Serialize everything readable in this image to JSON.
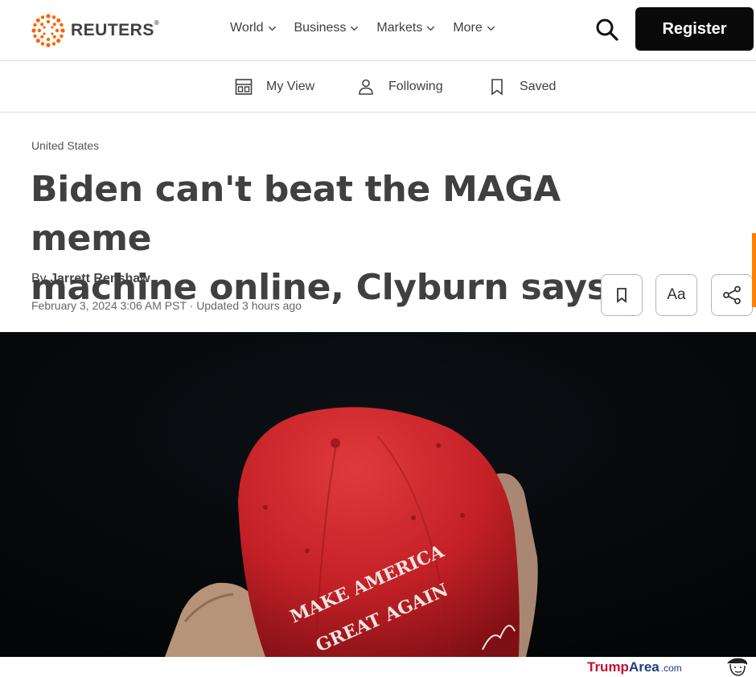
{
  "brand": {
    "name": "REUTERS",
    "registered": "®"
  },
  "nav": {
    "links": [
      {
        "label": "World"
      },
      {
        "label": "Business"
      },
      {
        "label": "Markets"
      },
      {
        "label": "More"
      }
    ],
    "register_label": "Register",
    "icons": {
      "search": "search-icon",
      "chevron": "chevron-down-icon"
    }
  },
  "subnav": {
    "items": [
      {
        "label": "My View",
        "icon": "layout-icon"
      },
      {
        "label": "Following",
        "icon": "person-icon"
      },
      {
        "label": "Saved",
        "icon": "bookmark-icon"
      }
    ]
  },
  "article": {
    "section": "United States",
    "headline_line1": "Biden can't beat the MAGA meme",
    "headline_line2": "machine online, Clyburn says",
    "by_prefix": "By",
    "author": "Jarrett Renshaw",
    "date": "February 3, 2024 3:06 AM PST",
    "updated": "· Updated 3 hours ago",
    "tools": {
      "bookmark": "bookmark-icon",
      "text_size_label": "Aa",
      "share": "share-icon"
    }
  },
  "photo": {
    "cap_text_line1": "MAKE AMERICA",
    "cap_text_line2": "GREAT AGAIN"
  },
  "watermark": {
    "part1": "Trump",
    "part2": "Area",
    "part3": ".com"
  },
  "colors": {
    "register_bg": "#0a0a0a",
    "text": "#404040",
    "cap_red": "#c8262d",
    "accent_orange": "#ff8000",
    "watermark_red": "#c8102e",
    "watermark_blue": "#1e3a8a"
  }
}
